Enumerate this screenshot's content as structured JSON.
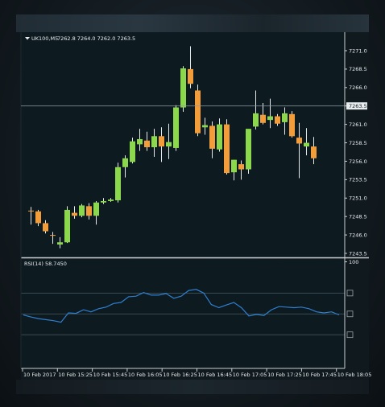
{
  "window": {
    "symbol_label": "UK100,M5",
    "ohlc_label": "7262.8 7264.0 7262.0 7263.5",
    "current_price_label": "7263.5",
    "rsi_label": "RSI(14) 58.7450"
  },
  "colors": {
    "background": "#0d1a20",
    "grid": "#4a5a62",
    "axis": "#c9cfd3",
    "bull": "#8bd84c",
    "bear": "#f39c3a",
    "wick": "#e6e9eb",
    "rsi_line": "#2f7fd0"
  },
  "chart_data": [
    {
      "type": "candlestick",
      "symbol": "UK100",
      "timeframe": "M5",
      "y_ticks": [
        "7271.0",
        "7268.5",
        "7266.0",
        "7263.5",
        "7261.0",
        "7258.5",
        "7256.0",
        "7253.5",
        "7251.0",
        "7248.5",
        "7246.0",
        "7243.5"
      ],
      "ylim": [
        7242.5,
        7272.5
      ],
      "current_price": 7263.5,
      "x_tick_labels": [
        "10 Feb 2017",
        "10 Feb 15:25",
        "10 Feb 15:45",
        "10 Feb 16:05",
        "10 Feb 16:25",
        "10 Feb 16:45",
        "10 Feb 17:05",
        "10 Feb 17:25",
        "10 Feb 17:45",
        "10 Feb 18:05"
      ],
      "candles": [
        {
          "o": 7249.3,
          "h": 7249.8,
          "l": 7247.4,
          "c": 7249.2
        },
        {
          "o": 7249.2,
          "h": 7249.4,
          "l": 7247.2,
          "c": 7247.6
        },
        {
          "o": 7247.6,
          "h": 7248.0,
          "l": 7246.2,
          "c": 7246.5
        },
        {
          "o": 7246.0,
          "h": 7246.4,
          "l": 7244.8,
          "c": 7245.9
        },
        {
          "o": 7244.7,
          "h": 7245.7,
          "l": 7244.2,
          "c": 7245.0
        },
        {
          "o": 7245.0,
          "h": 7249.9,
          "l": 7244.9,
          "c": 7249.4
        },
        {
          "o": 7249.0,
          "h": 7249.9,
          "l": 7248.2,
          "c": 7248.6
        },
        {
          "o": 7248.6,
          "h": 7250.2,
          "l": 7248.4,
          "c": 7250.0
        },
        {
          "o": 7249.9,
          "h": 7250.3,
          "l": 7248.1,
          "c": 7248.6
        },
        {
          "o": 7248.6,
          "h": 7250.6,
          "l": 7247.4,
          "c": 7250.4
        },
        {
          "o": 7250.4,
          "h": 7251.0,
          "l": 7250.2,
          "c": 7250.6
        },
        {
          "o": 7250.6,
          "h": 7251.0,
          "l": 7250.5,
          "c": 7250.8
        },
        {
          "o": 7250.7,
          "h": 7255.8,
          "l": 7250.4,
          "c": 7255.2
        },
        {
          "o": 7255.2,
          "h": 7256.8,
          "l": 7253.8,
          "c": 7256.4
        },
        {
          "o": 7255.9,
          "h": 7259.2,
          "l": 7255.7,
          "c": 7258.7
        },
        {
          "o": 7258.3,
          "h": 7260.4,
          "l": 7257.4,
          "c": 7259.0
        },
        {
          "o": 7258.8,
          "h": 7260.0,
          "l": 7257.4,
          "c": 7257.9
        },
        {
          "o": 7257.9,
          "h": 7260.4,
          "l": 7256.6,
          "c": 7259.4
        },
        {
          "o": 7259.4,
          "h": 7260.6,
          "l": 7255.9,
          "c": 7258.0
        },
        {
          "o": 7258.0,
          "h": 7261.1,
          "l": 7256.3,
          "c": 7258.6
        },
        {
          "o": 7257.8,
          "h": 7263.6,
          "l": 7257.4,
          "c": 7263.3
        },
        {
          "o": 7263.3,
          "h": 7268.9,
          "l": 7262.7,
          "c": 7268.6
        },
        {
          "o": 7268.5,
          "h": 7271.6,
          "l": 7265.9,
          "c": 7266.5
        },
        {
          "o": 7265.6,
          "h": 7266.4,
          "l": 7259.4,
          "c": 7259.8
        },
        {
          "o": 7260.6,
          "h": 7261.9,
          "l": 7259.6,
          "c": 7260.9
        },
        {
          "o": 7260.8,
          "h": 7261.4,
          "l": 7256.4,
          "c": 7257.7
        },
        {
          "o": 7257.6,
          "h": 7261.8,
          "l": 7257.3,
          "c": 7261.0
        },
        {
          "o": 7261.0,
          "h": 7261.7,
          "l": 7254.2,
          "c": 7254.4
        },
        {
          "o": 7254.5,
          "h": 7256.2,
          "l": 7253.4,
          "c": 7256.2
        },
        {
          "o": 7255.6,
          "h": 7256.1,
          "l": 7253.5,
          "c": 7254.9
        },
        {
          "o": 7254.9,
          "h": 7260.2,
          "l": 7254.3,
          "c": 7260.4
        },
        {
          "o": 7260.7,
          "h": 7265.6,
          "l": 7260.3,
          "c": 7262.5
        },
        {
          "o": 7262.3,
          "h": 7263.9,
          "l": 7261.0,
          "c": 7261.2
        },
        {
          "o": 7261.6,
          "h": 7264.5,
          "l": 7260.5,
          "c": 7262.1
        },
        {
          "o": 7262.1,
          "h": 7262.4,
          "l": 7260.8,
          "c": 7261.1
        },
        {
          "o": 7261.3,
          "h": 7263.3,
          "l": 7259.6,
          "c": 7262.5
        },
        {
          "o": 7262.4,
          "h": 7262.8,
          "l": 7259.2,
          "c": 7259.4
        },
        {
          "o": 7259.2,
          "h": 7261.2,
          "l": 7253.7,
          "c": 7258.4
        },
        {
          "o": 7258.0,
          "h": 7260.5,
          "l": 7256.8,
          "c": 7258.5
        },
        {
          "o": 7258.0,
          "h": 7259.3,
          "l": 7255.6,
          "c": 7256.4
        }
      ]
    },
    {
      "type": "line",
      "name": "RSI(14)",
      "last_value": 58.745,
      "ylim": [
        0,
        100
      ],
      "y_ticks": [
        "100"
      ],
      "levels": [
        70,
        50,
        30
      ],
      "values": [
        49.0,
        47.0,
        45.5,
        44.5,
        43.5,
        42.0,
        51.0,
        50.5,
        54.0,
        52.0,
        55.0,
        56.5,
        60.0,
        61.0,
        66.5,
        67.0,
        70.5,
        68.0,
        68.0,
        69.5,
        65.0,
        67.0,
        72.5,
        73.5,
        70.0,
        59.0,
        56.0,
        58.5,
        61.0,
        56.0,
        48.0,
        49.5,
        48.5,
        54.0,
        57.0,
        56.5,
        56.0,
        56.5,
        55.0,
        52.0,
        51.0,
        52.0,
        49.0
      ]
    }
  ]
}
